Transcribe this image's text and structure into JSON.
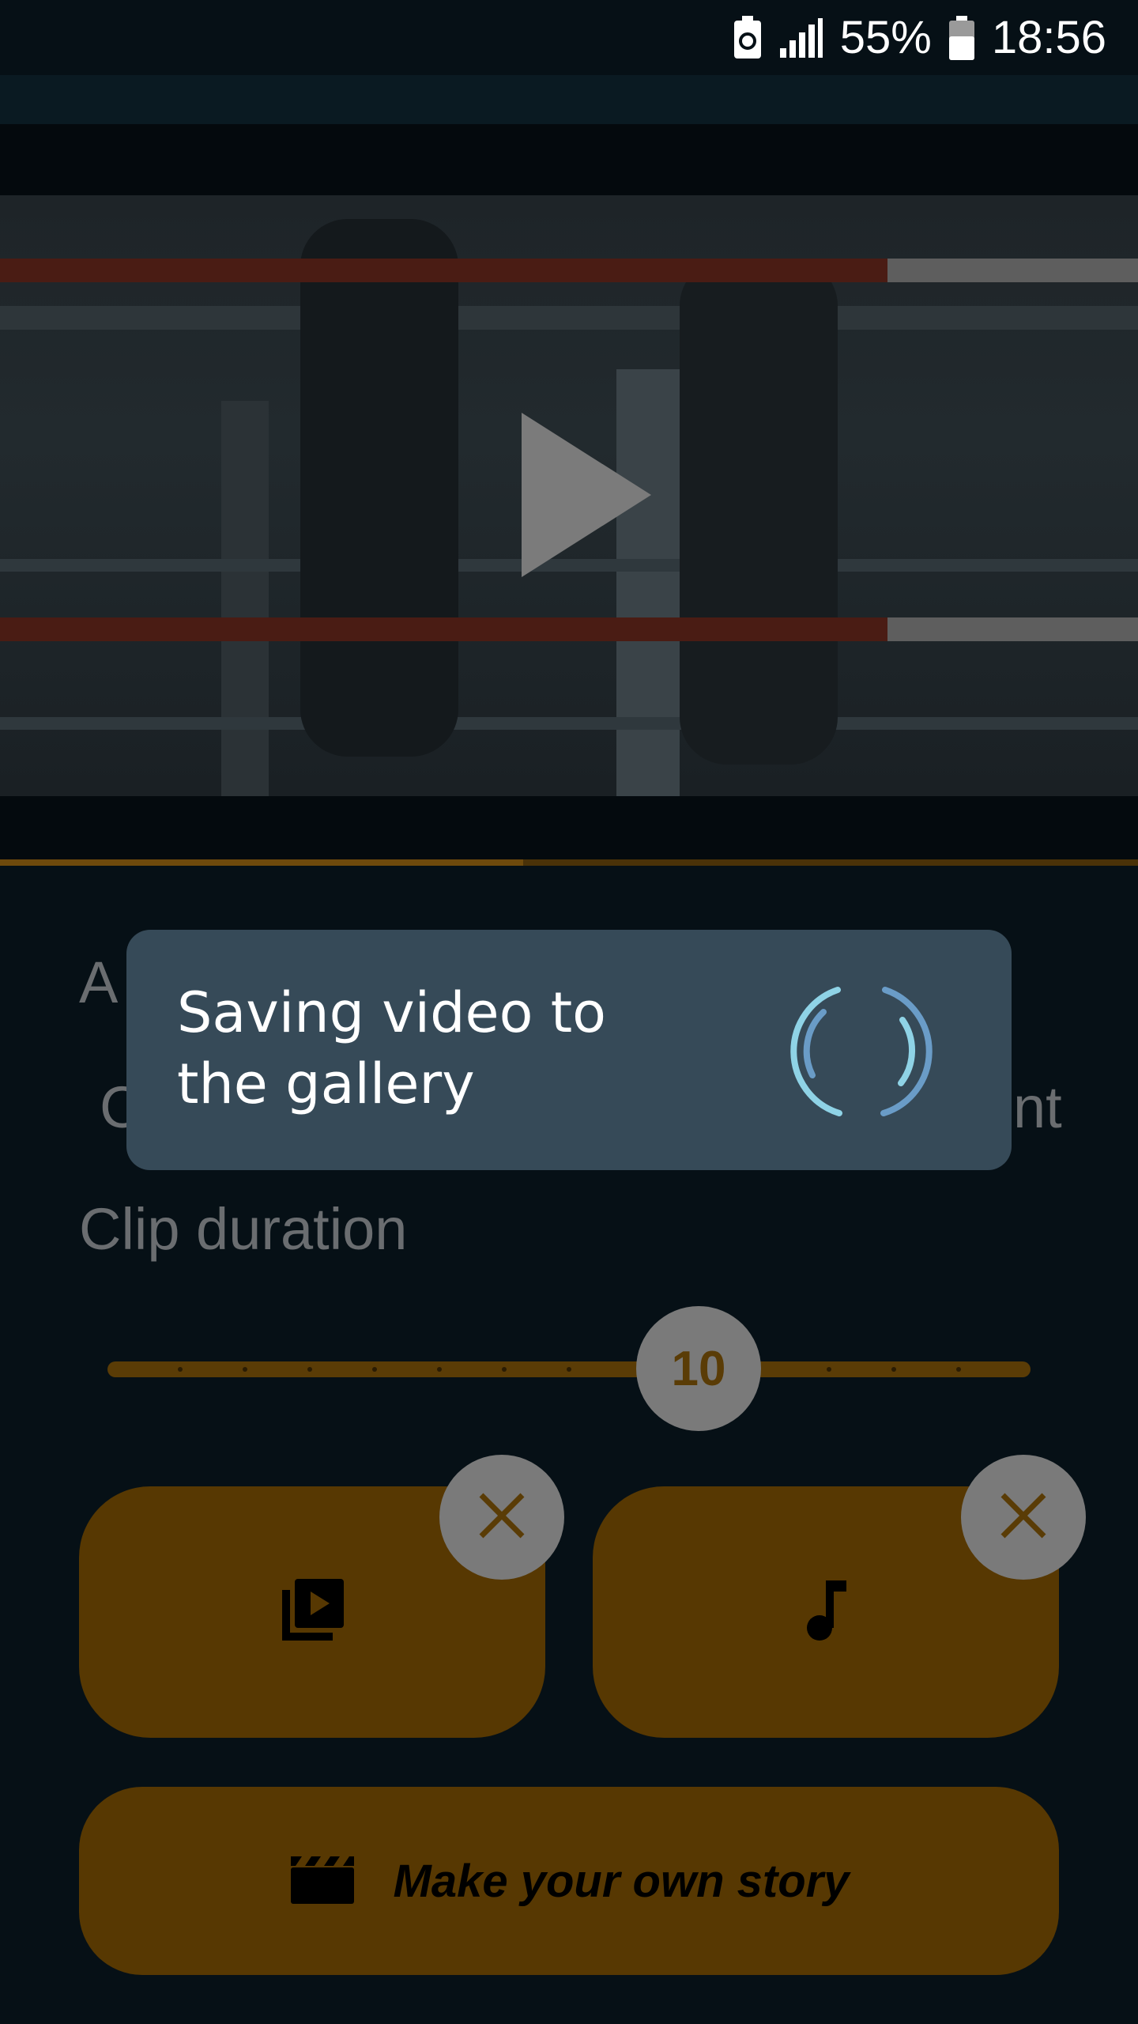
{
  "status_bar": {
    "battery_percent": "55%",
    "time": "18:56"
  },
  "background_labels": {
    "row1_fragment_left": "A",
    "row2_fragment_left": "C",
    "row2_fragment_right": "nt",
    "clip_duration": "Clip duration"
  },
  "slider": {
    "value": "10",
    "position_fraction": 0.64
  },
  "playback_progress_fraction": 0.46,
  "buttons": {
    "make_story": "Make your own story"
  },
  "dialog": {
    "message": "Saving video to the gallery"
  },
  "colors": {
    "accent": "#573802",
    "dialog_bg": "#364a58",
    "spinner_light": "#8fd3e6",
    "spinner_dark": "#6a9cc7"
  },
  "icons": {
    "video_library": "video-library-icon",
    "music_note": "music-note-icon",
    "clapperboard": "clapperboard-icon",
    "close": "close-icon",
    "play": "play-icon"
  }
}
